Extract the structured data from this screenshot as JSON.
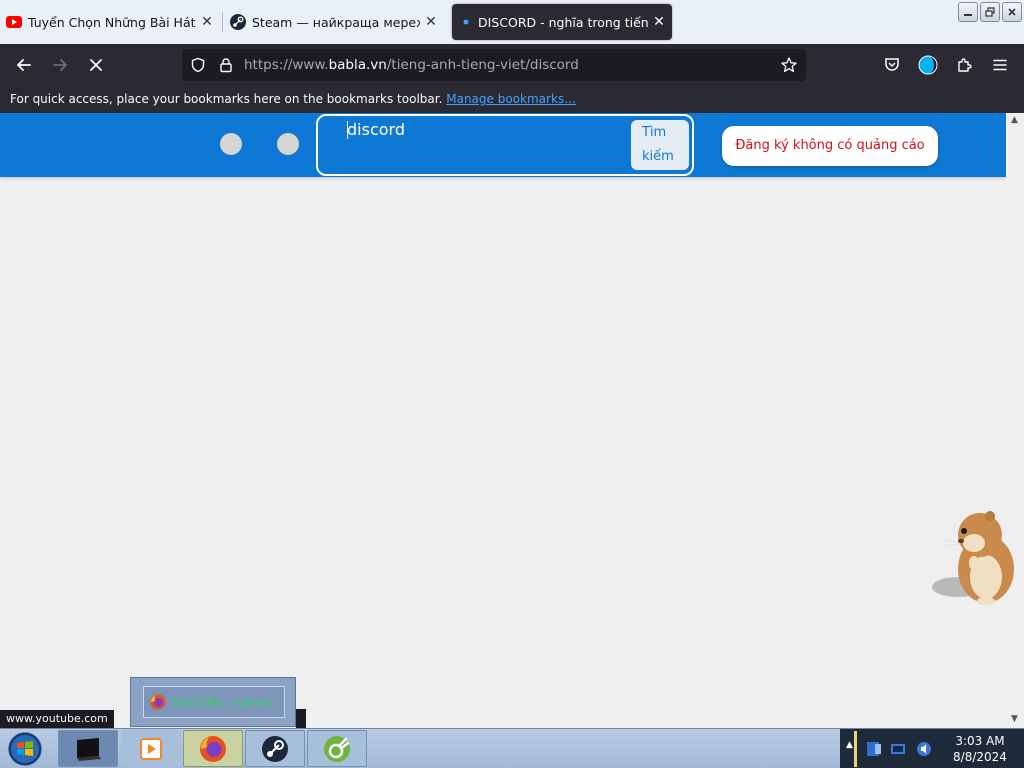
{
  "tabs": [
    {
      "title": "Tuyển Chọn Những Bài Hát Về Đ",
      "icon": "youtube-icon",
      "active": false
    },
    {
      "title": "Steam — найкраща мережева",
      "icon": "steam-icon",
      "active": false
    },
    {
      "title": "DISCORD - nghĩa trong tiếng Ti",
      "icon": "loading-dot-icon",
      "active": true
    }
  ],
  "tab_close_symbol": "✕",
  "window_controls": [
    "minimize",
    "restore",
    "close"
  ],
  "nav": {
    "url_prefix": "https://www.",
    "url_host": "babla.vn",
    "url_path": "/tieng-anh-tieng-viet/discord"
  },
  "bookmarks": {
    "message": "For quick access, place your bookmarks here on the bookmarks toolbar.",
    "link": "Manage bookmarks…"
  },
  "page": {
    "search": {
      "value": "discord",
      "button_label_line1": "Tìm",
      "button_label_line2": "kiếm"
    },
    "ad_free_button": "Đăng ký không có quảng cáo"
  },
  "status": {
    "hover_url": "www.youtube.com"
  },
  "preview": {
    "label": "DISCORD - nghĩa t"
  },
  "taskbar": {
    "buttons": [
      "media-player-icon",
      "firefox-icon",
      "steam-icon",
      "app-icon"
    ],
    "clock_time": "3:03 AM",
    "clock_date": "8/8/2024"
  },
  "colors": {
    "brand_blue": "#0e79d4",
    "ad_button_text": "#d0111b",
    "browser_chrome": "#2b2a33",
    "link_blue": "#45a1ff",
    "youtube_red": "#ff0000",
    "preview_label": "#2bd96b"
  }
}
